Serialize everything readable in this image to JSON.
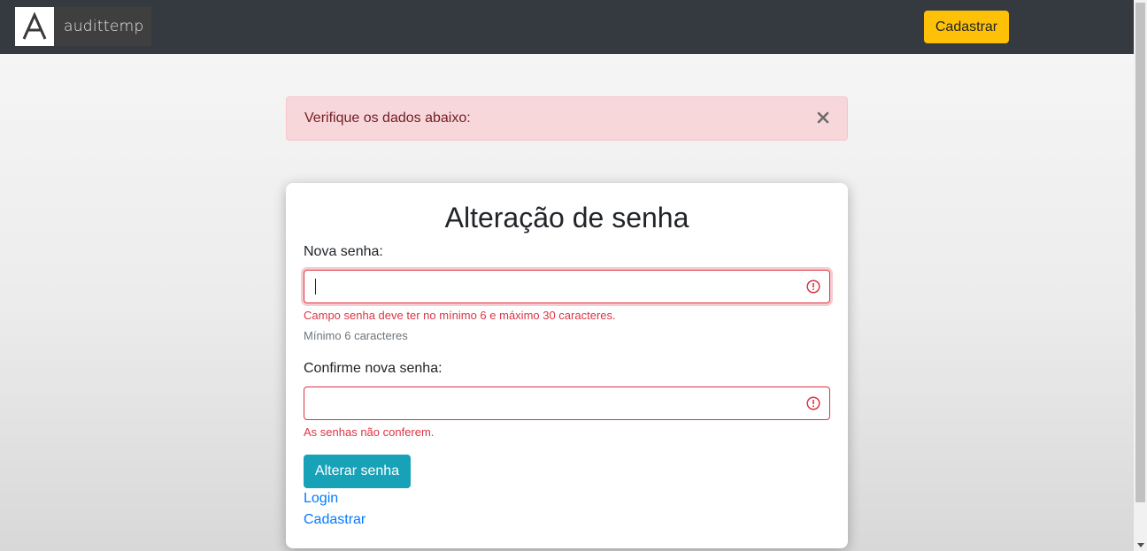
{
  "navbar": {
    "brand_name": "audittemp",
    "brand_logo_letter": "A",
    "register_button": "Cadastrar"
  },
  "alert": {
    "message": "Verifique os dados abaixo:",
    "close_icon": "close-icon"
  },
  "form": {
    "title": "Alteração de senha",
    "new_password": {
      "label": "Nova senha:",
      "value": "",
      "error": "Campo senha deve ter no mínimo 6 e máximo 30 caracteres.",
      "help": "Mínimo 6 caracteres"
    },
    "confirm_password": {
      "label": "Confirme nova senha:",
      "value": "",
      "error": "As senhas não conferem."
    },
    "submit_button": "Alterar senha",
    "links": {
      "login": "Login",
      "register": "Cadastrar"
    }
  },
  "colors": {
    "navbar_bg": "#343a40",
    "warning": "#ffc107",
    "danger": "#dc3545",
    "info": "#17a2b8",
    "link": "#007bff"
  }
}
